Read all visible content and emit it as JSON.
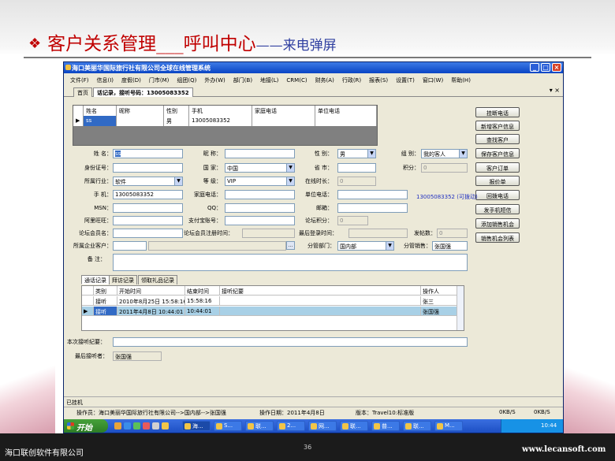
{
  "slide": {
    "bullet": "❖",
    "title_main": "客户关系管理___呼叫中心",
    "title_sub": "——来电弹屏",
    "footer_company": "海口联创软件有限公司",
    "page_number": "36",
    "footer_site": "www.lecansoft.com"
  },
  "window": {
    "title": "海口美丽华国际旅行社有限公司全球在线管理系统",
    "menu": [
      "文件(F)",
      "信息(I)",
      "度假(D)",
      "门市(M)",
      "组团(Q)",
      "外办(W)",
      "部门(B)",
      "地接(L)",
      "CRM(C)",
      "财务(A)",
      "行政(R)",
      "报表(S)",
      "设置(T)",
      "窗口(W)",
      "帮助(H)"
    ],
    "tabs": [
      "首页",
      "话记录，接听号码：13005083352"
    ],
    "caption_buttons": [
      "_",
      "□",
      "×"
    ],
    "panel_close": "▾ ×"
  },
  "caller_grid": {
    "headers": [
      "姓名",
      "昵称",
      "性别",
      "手机",
      "家庭电话",
      "单位电话"
    ],
    "row": [
      "ss",
      "",
      "男",
      "13005083352",
      "",
      ""
    ]
  },
  "buttons": [
    "挂断电话",
    "新增客户信息",
    "查找客户",
    "保存客户信息",
    "客户订单",
    "报价单",
    "回拨电话",
    "发手机短信",
    "添加销售机会",
    "销售机会列表"
  ],
  "callback_link": "13005083352 (可拨动)",
  "form": {
    "name_label": "姓    名：",
    "name_value": "ss",
    "nick_label": "昵    称：",
    "nick_value": "",
    "gender_label": "性    别：",
    "gender_value": "男",
    "group_label": "组    别：",
    "group_value": "我的客人",
    "id_label": "身份证号：",
    "id_value": "",
    "country_label": "国    家：",
    "country_value": "中国",
    "province_label": "省    市：",
    "province_value": "",
    "points_label": "积分：",
    "points_value": "0",
    "industry_label": "所属行业：",
    "industry_value": "软件",
    "level_label": "等    级：",
    "level_value": "VIP",
    "online_label": "在线时长：",
    "online_value": "0",
    "mobile_label": "手    机：",
    "mobile_value": "13005083352",
    "home_phone_label": "家庭电话：",
    "home_phone_value": "",
    "work_phone_label": "单位电话：",
    "work_phone_value": "",
    "msn_label": "MSN：",
    "msn_value": "",
    "qq_label": "QQ：",
    "qq_value": "",
    "email_label": "邮箱：",
    "email_value": "",
    "aliwangwang_label": "阿里旺旺：",
    "aliwangwang_value": "",
    "alipay_label": "支付宝账号：",
    "alipay_value": "",
    "forum_points_label": "论坛积分：",
    "forum_points_value": "0",
    "forum_member_label": "论坛会员名：",
    "forum_member_value": "",
    "forum_reg_label": "论坛会员注册时间：",
    "forum_reg_value": "",
    "last_login_label": "最后登录时间：",
    "last_login_value": "",
    "posts_label": "发帖数：",
    "posts_value": "0",
    "company_label": "所属企业客户：",
    "company_value": "",
    "dept_label": "分管部门：",
    "dept_value": "国内部",
    "sales_label": "分管销售：",
    "sales_value": "张国强",
    "remark_label": "备    注：",
    "remark_value": ""
  },
  "records": {
    "tabs": [
      "通话记录",
      "拜访记录",
      "领取礼品记录"
    ],
    "headers": [
      "类别",
      "开始时间",
      "结束时间",
      "接听纪要",
      "操作人"
    ],
    "rows": [
      [
        "接听",
        "2010年8月25日 15:58:16",
        "15:58:16",
        "",
        "张三"
      ],
      [
        "接听",
        "2011年4月8日 10:44:01",
        "10:44:01",
        "",
        "张国强"
      ]
    ]
  },
  "summary_label": "本次接听纪要：",
  "summary_value": "",
  "last_taker_label": "最后接听者：",
  "last_taker_value": "张国强",
  "status": {
    "line1": "已挂机",
    "operator": "操作员：海口美丽华国际旅行社有限公司-->国内部-->张国强",
    "op_time": "操作日期：2011年4月8日",
    "version": "版本：Travel10:标准版",
    "net1": "0KB/S",
    "net2": "0KB/S"
  },
  "taskbar": {
    "start": "开始",
    "items": [
      "海...",
      "S...",
      "联...",
      "2...",
      "网...",
      "联...",
      "普...",
      "联...",
      "M..."
    ],
    "time": "10:44"
  }
}
